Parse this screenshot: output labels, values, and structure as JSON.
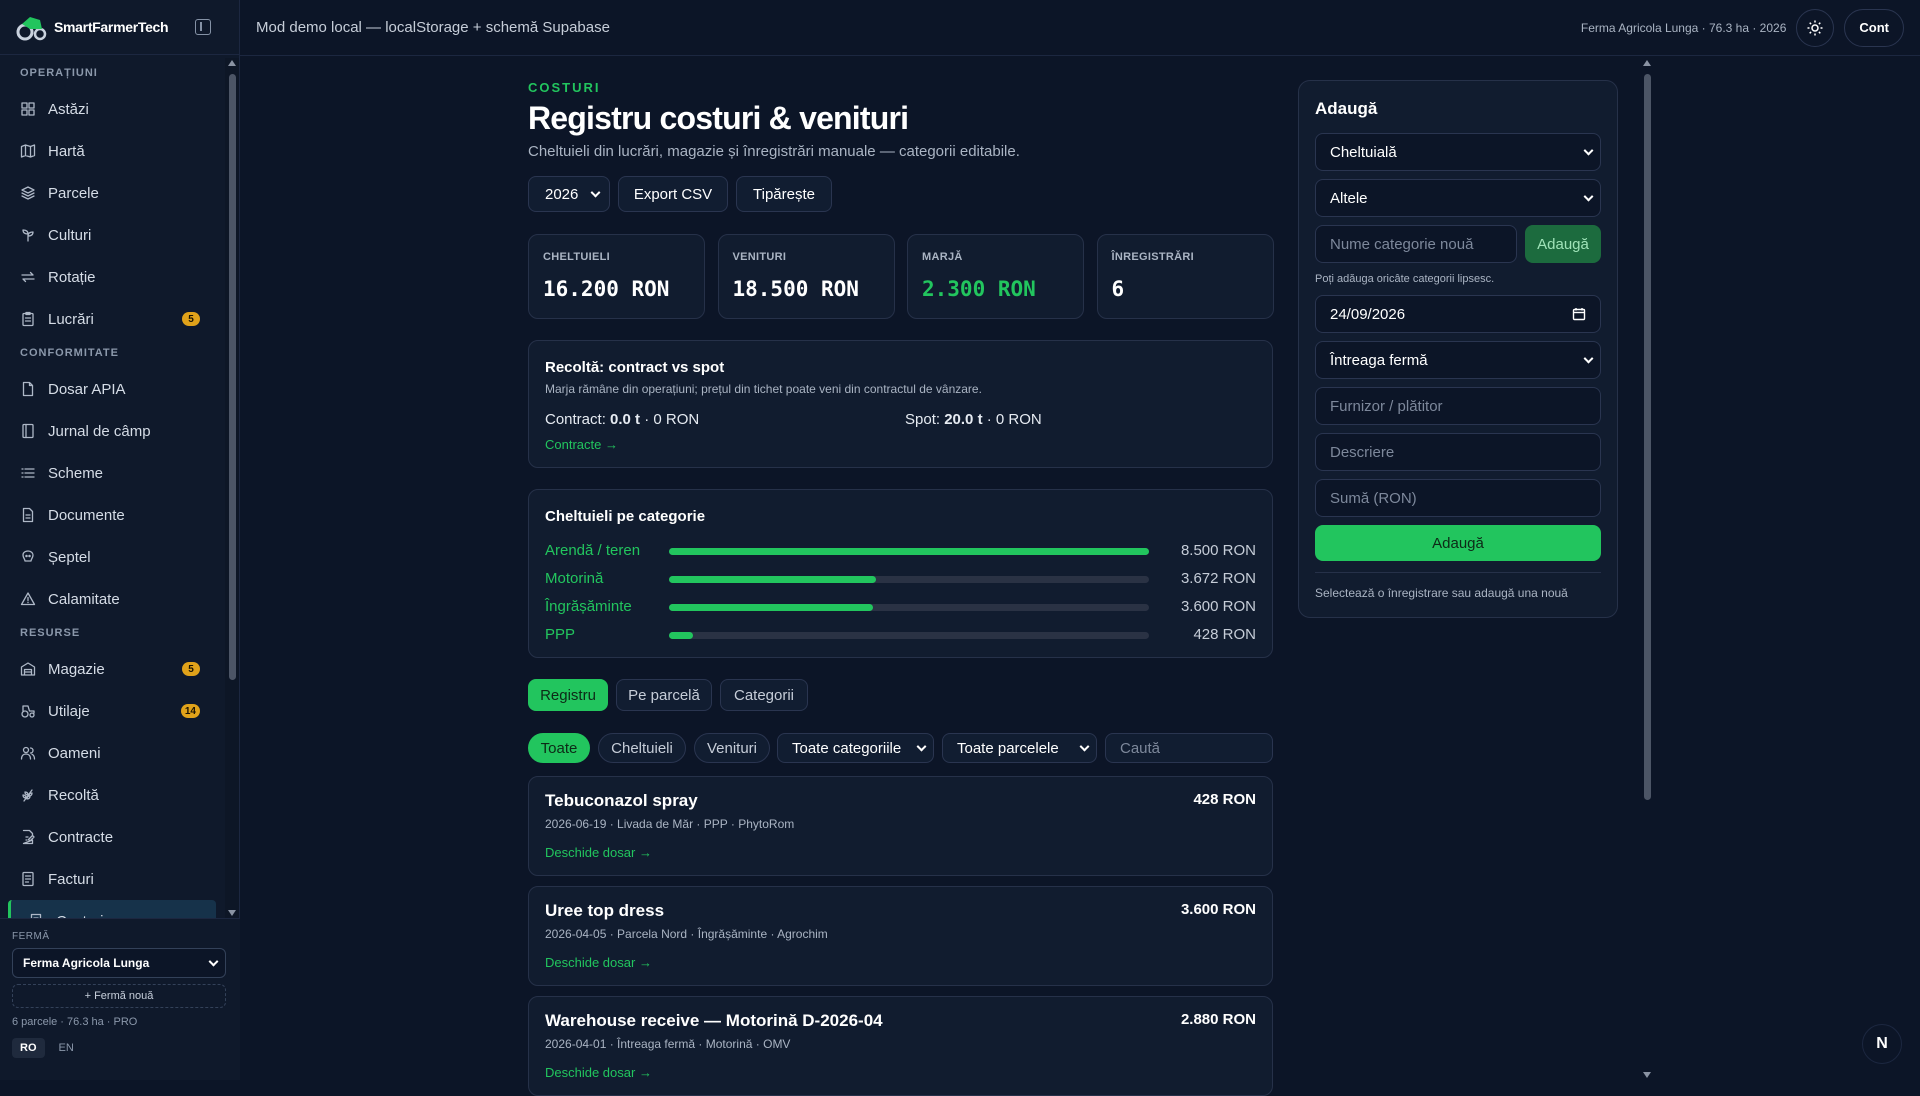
{
  "brand": {
    "name": "SmartFarmerTech"
  },
  "topbar": {
    "mode_text": "Mod demo local — localStorage + schemă Supabase",
    "farm_info": "Ferma Agricola Lunga · 76.3 ha · 2026",
    "account_label": "Cont"
  },
  "sidebar": {
    "sections": [
      {
        "title": "OPERAȚIUNI",
        "items": [
          {
            "label": "Astăzi",
            "icon": "grid-icon"
          },
          {
            "label": "Hartă",
            "icon": "map-icon"
          },
          {
            "label": "Parcele",
            "icon": "layers-icon"
          },
          {
            "label": "Culturi",
            "icon": "sprout-icon"
          },
          {
            "label": "Rotație",
            "icon": "repeat-icon"
          },
          {
            "label": "Lucrări",
            "icon": "clipboard-icon",
            "badge": "5"
          }
        ]
      },
      {
        "title": "CONFORMITATE",
        "items": [
          {
            "label": "Dosar APIA",
            "icon": "file-icon"
          },
          {
            "label": "Jurnal de câmp",
            "icon": "notebook-icon"
          },
          {
            "label": "Scheme",
            "icon": "list-icon"
          },
          {
            "label": "Documente",
            "icon": "document-icon"
          },
          {
            "label": "Șeptel",
            "icon": "cow-icon"
          },
          {
            "label": "Calamitate",
            "icon": "warning-icon"
          }
        ]
      },
      {
        "title": "RESURSE",
        "items": [
          {
            "label": "Magazie",
            "icon": "warehouse-icon",
            "badge": "5"
          },
          {
            "label": "Utilaje",
            "icon": "tractor-icon",
            "badge": "14"
          },
          {
            "label": "Oameni",
            "icon": "users-icon"
          },
          {
            "label": "Recoltă",
            "icon": "wheat-icon"
          },
          {
            "label": "Contracte",
            "icon": "contract-icon"
          },
          {
            "label": "Facturi",
            "icon": "invoice-icon"
          },
          {
            "label": "Costuri",
            "icon": "receipt-icon",
            "active": true
          }
        ]
      }
    ],
    "farm_label": "FERMĂ",
    "farm_selected": "Ferma Agricola Lunga",
    "new_farm": "+ Fermă nouă",
    "farm_meta": "6 parcele · 76.3 ha · PRO",
    "lang": [
      "RO",
      "EN"
    ]
  },
  "page": {
    "eyebrow": "COSTURI",
    "title": "Registru costuri & venituri",
    "subtitle": "Cheltuieli din lucrări, magazie și înregistrări manuale — categorii editabile.",
    "year": "2026",
    "export_label": "Export CSV",
    "print_label": "Tipărește"
  },
  "stats": [
    {
      "label": "CHELTUIELI",
      "value": "16.200 RON"
    },
    {
      "label": "VENITURI",
      "value": "18.500 RON"
    },
    {
      "label": "MARJĂ",
      "value": "2.300 RON",
      "green": true
    },
    {
      "label": "ÎNREGISTRĂRI",
      "value": "6"
    }
  ],
  "harvest": {
    "title": "Recoltă: contract vs spot",
    "note": "Marja rămâne din operațiuni; prețul din tichet poate veni din contractul de vânzare.",
    "contract_label": "Contract:",
    "contract_qty": "0.0 t",
    "contract_amt": "· 0 RON",
    "spot_label": "Spot:",
    "spot_qty": "20.0 t",
    "spot_amt": "· 0 RON",
    "link": "Contracte →"
  },
  "categories": {
    "title": "Cheltuieli pe categorie",
    "items": [
      {
        "name": "Arendă / teren",
        "amount": "8.500 RON",
        "pct": 100
      },
      {
        "name": "Motorină",
        "amount": "3.672 RON",
        "pct": 43.2
      },
      {
        "name": "Îngrășăminte",
        "amount": "3.600 RON",
        "pct": 42.4
      },
      {
        "name": "PPP",
        "amount": "428 RON",
        "pct": 5
      }
    ]
  },
  "tabs": [
    "Registru",
    "Pe parcelă",
    "Categorii"
  ],
  "filters": {
    "chips": [
      "Toate",
      "Cheltuieli",
      "Venituri"
    ],
    "category": "Toate categoriile",
    "parcel": "Toate parcelele",
    "search_placeholder": "Caută"
  },
  "records": [
    {
      "title": "Tebuconazol spray",
      "amount": "428 RON",
      "meta": "2026-06-19 · Livada de Măr · PPP · PhytoRom",
      "link": "Deschide dosar →"
    },
    {
      "title": "Uree top dress",
      "amount": "3.600 RON",
      "meta": "2026-04-05 · Parcela Nord · Îngrășăminte · Agrochim",
      "link": "Deschide dosar →"
    },
    {
      "title": "Warehouse receive — Motorină D-2026-04",
      "amount": "2.880 RON",
      "meta": "2026-04-01 · Întreaga fermă · Motorină · OMV",
      "link": "Deschide dosar →"
    }
  ],
  "form": {
    "title": "Adaugă",
    "type": "Cheltuială",
    "category": "Altele",
    "new_cat_placeholder": "Nume categorie nouă",
    "new_cat_btn": "Adaugă",
    "hint": "Poți adăuga oricâte categorii lipsesc.",
    "date": "24/09/2026",
    "scope": "Întreaga fermă",
    "supplier_placeholder": "Furnizor / plătitor",
    "desc_placeholder": "Descriere",
    "sum_placeholder": "Sumă (RON)",
    "submit": "Adaugă",
    "footer": "Selectează o înregistrare sau adaugă una nouă"
  },
  "fab": {
    "label": "N"
  }
}
